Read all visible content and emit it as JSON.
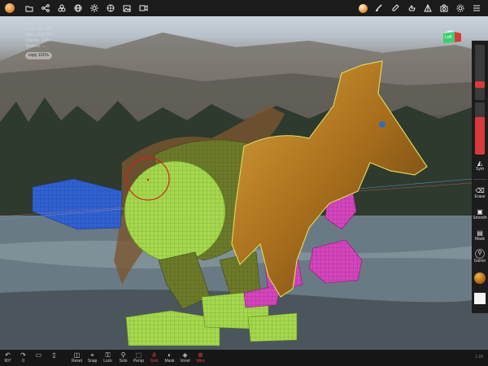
{
  "top_toolbar": {
    "left_icons": [
      "app-logo",
      "folder-icon",
      "share-icon",
      "layers-icon",
      "sphere-icon",
      "light-icon",
      "image-icon",
      "video-icon"
    ],
    "right_icons": [
      "material-sphere-icon",
      "brush-icon",
      "paint-icon",
      "move-icon",
      "transform-icon",
      "settings-icon",
      "scene-icon",
      "menu-icon"
    ]
  },
  "stats": {
    "line1": "RAM",
    "line2": "Used: 367 MB",
    "line3": "Free: 2560 MB",
    "line4": "Objects: 1.6M",
    "line5": "Vertices: ...",
    "copy_label": "copy 101%"
  },
  "view_cube": {
    "label": "Left",
    "colors": [
      "#38c86a",
      "#d63b3b"
    ]
  },
  "right_panel": {
    "radius_level": 0.22,
    "intensity_level": 0.72,
    "sym_label": "Sym",
    "erase_label": "Erase",
    "smooth_label": "Smooth",
    "mask_label": "Mask",
    "gizmo_label": "Gizmo"
  },
  "bottom_toolbar": {
    "version": "1.68",
    "items": [
      {
        "icon": "undo-icon",
        "glyph": "↶",
        "label": "907"
      },
      {
        "icon": "redo-icon",
        "glyph": "↷",
        "label": "0"
      },
      {
        "icon": "sculpt-icon",
        "glyph": "▭",
        "label": ""
      },
      {
        "icon": "secondary-icon",
        "glyph": "▯",
        "label": ""
      },
      {
        "icon": "reset-icon",
        "glyph": "◫",
        "label": "Reset"
      },
      {
        "icon": "snap-icon",
        "glyph": "⌖",
        "label": "Snap"
      },
      {
        "icon": "lock-icon",
        "glyph": "⚿",
        "label": "Lock"
      },
      {
        "icon": "solo-icon",
        "glyph": "⚲",
        "label": "Solo"
      },
      {
        "icon": "persp-icon",
        "glyph": "⬚",
        "label": "Persp"
      },
      {
        "icon": "grid-icon",
        "glyph": "#",
        "label": "Grid",
        "active": true
      },
      {
        "icon": "mask-icon",
        "glyph": "◐",
        "label": "Mask"
      },
      {
        "icon": "voxel-icon",
        "glyph": "◈",
        "label": "Voxel"
      },
      {
        "icon": "wire-icon",
        "glyph": "⊛",
        "label": "Wire",
        "active": true
      }
    ]
  },
  "colors": {
    "accent_red": "#d83a3a",
    "mesh_green": "#9bd64a",
    "mesh_olive": "#6e7a2a",
    "mesh_magenta": "#d23ab8",
    "mesh_blue": "#2a55c8"
  }
}
